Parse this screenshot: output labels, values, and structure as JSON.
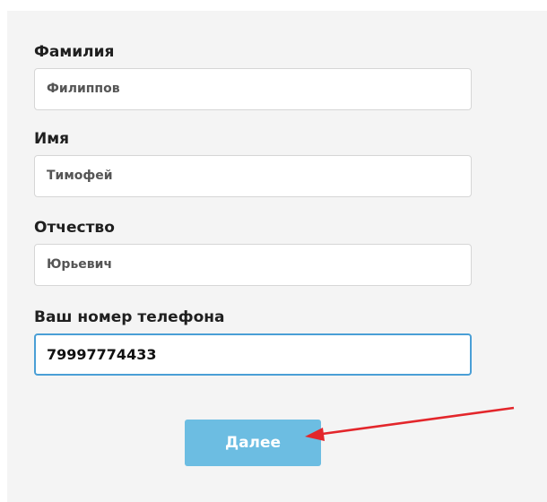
{
  "form": {
    "fields": [
      {
        "label": "Фамилия",
        "value": "Филиппов"
      },
      {
        "label": "Имя",
        "value": "Тимофей"
      },
      {
        "label": "Отчество",
        "value": "Юрьевич"
      },
      {
        "label": "Ваш номер телефона",
        "value": "79997774433"
      }
    ],
    "submit_label": "Далее"
  },
  "annotation": {
    "arrow_color": "#e3262b"
  }
}
